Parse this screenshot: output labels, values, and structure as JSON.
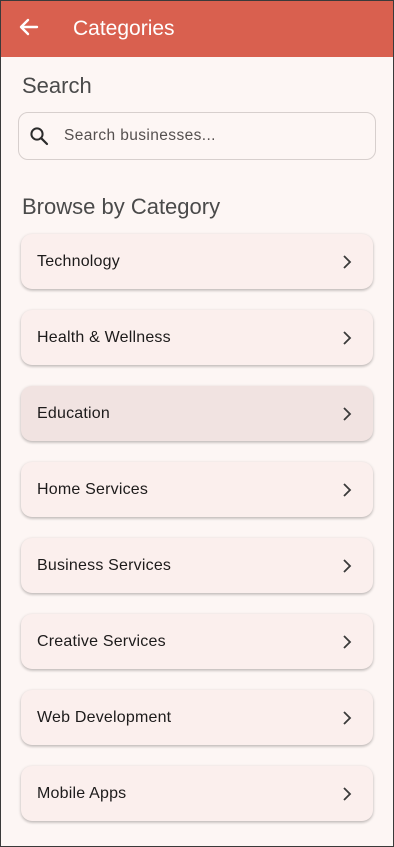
{
  "appbar": {
    "title": "Categories",
    "back_icon": "arrow-back-icon",
    "color": "#d9604f"
  },
  "search": {
    "heading": "Search",
    "placeholder": "Search businesses...",
    "value": "",
    "icon": "search-icon"
  },
  "browse": {
    "heading": "Browse by Category",
    "categories": [
      {
        "label": "Technology"
      },
      {
        "label": "Health & Wellness"
      },
      {
        "label": "Education"
      },
      {
        "label": "Home Services"
      },
      {
        "label": "Business Services"
      },
      {
        "label": "Creative Services"
      },
      {
        "label": "Web Development"
      },
      {
        "label": "Mobile Apps"
      }
    ],
    "highlighted_index": 2
  }
}
